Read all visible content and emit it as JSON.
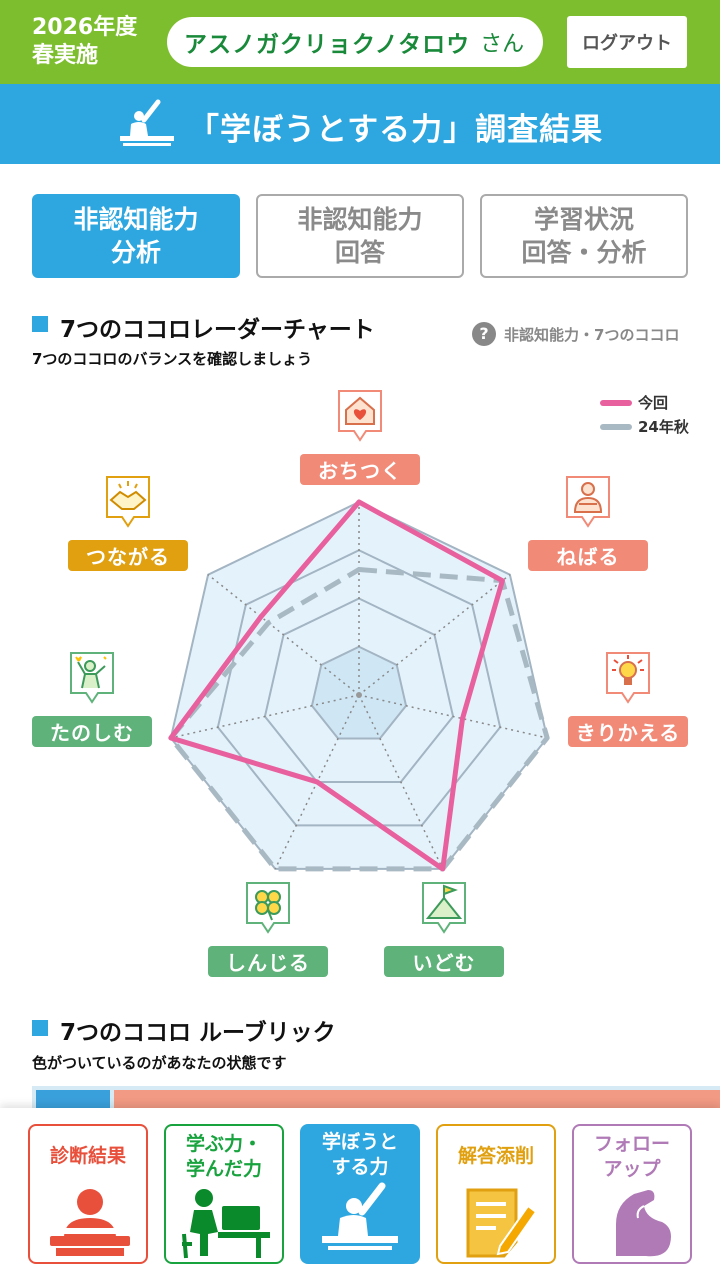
{
  "header": {
    "fiscal_line1": "2026年度",
    "fiscal_line2": "春実施",
    "user_name": "アスノガクリョクノタロウ",
    "user_suffix": "さん",
    "logout_label": "ログアウト"
  },
  "title_bar": {
    "icon": "student-raising-hand-icon",
    "title": "「学ぼうとする力」調査結果"
  },
  "tabs": [
    {
      "line1": "非認知能力",
      "line2": "分析",
      "active": true
    },
    {
      "line1": "非認知能力",
      "line2": "回答",
      "active": false
    },
    {
      "line1": "学習状況",
      "line2": "回答・分析",
      "active": false
    }
  ],
  "radar_section": {
    "title": "7つのココロレーダーチャート",
    "description": "7つのココロのバランスを確認しましょう",
    "help_icon": "question-circle-icon",
    "help_text": "非認知能力・7つのココロ"
  },
  "chart_data": {
    "type": "radar",
    "axes": [
      "おちつく",
      "ねばる",
      "きりかえる",
      "いどむ",
      "しんじる",
      "たのしむ",
      "つながる"
    ],
    "range": [
      0,
      4
    ],
    "levels": 4,
    "series": [
      {
        "name": "今回",
        "color": "#e8609e",
        "style": "solid",
        "values": [
          4,
          3.8,
          2.2,
          4,
          2,
          4,
          2.6
        ]
      },
      {
        "name": "24年秋",
        "color": "#a9b9c4",
        "style": "dashed",
        "values": [
          2.6,
          3.8,
          4,
          4,
          4,
          4,
          2.4
        ]
      }
    ]
  },
  "kokoro": [
    {
      "label": "おちつく",
      "icon": "house-heart-icon",
      "color": "#f28a78"
    },
    {
      "label": "ねばる",
      "icon": "person-arms-crossed-icon",
      "color": "#f28a78"
    },
    {
      "label": "きりかえる",
      "icon": "lightbulb-icon",
      "color": "#f28a78"
    },
    {
      "label": "いどむ",
      "icon": "mountain-flag-icon",
      "color": "#5fb37a"
    },
    {
      "label": "しんじる",
      "icon": "clover-icon",
      "color": "#5fb37a"
    },
    {
      "label": "たのしむ",
      "icon": "person-cheering-icon",
      "color": "#5fb37a"
    },
    {
      "label": "つながる",
      "icon": "handshake-icon",
      "color": "#e0a010"
    }
  ],
  "rubric_section": {
    "title": "7つのココロ ルーブリック",
    "description": "色がついているのがあなたの状態です"
  },
  "bottom_nav": [
    {
      "line1": "診断結果",
      "line2": "",
      "icon": "person-at-desk-icon",
      "color": "#e8503c"
    },
    {
      "line1": "学ぶ力・",
      "line2": "学んだ力",
      "icon": "student-at-computer-icon",
      "color": "#19a33e"
    },
    {
      "line1": "学ぼうと",
      "line2": "する力",
      "icon": "student-raising-hand-icon",
      "color": "#2ea7e0"
    },
    {
      "line1": "解答添削",
      "line2": "",
      "icon": "pencil-paper-icon",
      "color": "#e0a010"
    },
    {
      "line1": "フォロー",
      "line2": "アップ",
      "icon": "flexed-arm-icon",
      "color": "#b07ab7"
    }
  ]
}
